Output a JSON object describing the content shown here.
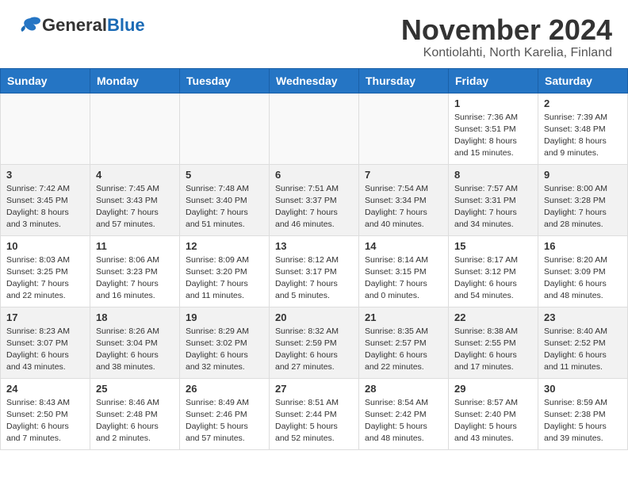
{
  "header": {
    "logo_general": "General",
    "logo_blue": "Blue",
    "title": "November 2024",
    "location": "Kontiolahti, North Karelia, Finland"
  },
  "days_of_week": [
    "Sunday",
    "Monday",
    "Tuesday",
    "Wednesday",
    "Thursday",
    "Friday",
    "Saturday"
  ],
  "weeks": [
    [
      {
        "day": "",
        "info": "",
        "empty": true
      },
      {
        "day": "",
        "info": "",
        "empty": true
      },
      {
        "day": "",
        "info": "",
        "empty": true
      },
      {
        "day": "",
        "info": "",
        "empty": true
      },
      {
        "day": "",
        "info": "",
        "empty": true
      },
      {
        "day": "1",
        "info": "Sunrise: 7:36 AM\nSunset: 3:51 PM\nDaylight: 8 hours\nand 15 minutes."
      },
      {
        "day": "2",
        "info": "Sunrise: 7:39 AM\nSunset: 3:48 PM\nDaylight: 8 hours\nand 9 minutes."
      }
    ],
    [
      {
        "day": "3",
        "info": "Sunrise: 7:42 AM\nSunset: 3:45 PM\nDaylight: 8 hours\nand 3 minutes."
      },
      {
        "day": "4",
        "info": "Sunrise: 7:45 AM\nSunset: 3:43 PM\nDaylight: 7 hours\nand 57 minutes."
      },
      {
        "day": "5",
        "info": "Sunrise: 7:48 AM\nSunset: 3:40 PM\nDaylight: 7 hours\nand 51 minutes."
      },
      {
        "day": "6",
        "info": "Sunrise: 7:51 AM\nSunset: 3:37 PM\nDaylight: 7 hours\nand 46 minutes."
      },
      {
        "day": "7",
        "info": "Sunrise: 7:54 AM\nSunset: 3:34 PM\nDaylight: 7 hours\nand 40 minutes."
      },
      {
        "day": "8",
        "info": "Sunrise: 7:57 AM\nSunset: 3:31 PM\nDaylight: 7 hours\nand 34 minutes."
      },
      {
        "day": "9",
        "info": "Sunrise: 8:00 AM\nSunset: 3:28 PM\nDaylight: 7 hours\nand 28 minutes."
      }
    ],
    [
      {
        "day": "10",
        "info": "Sunrise: 8:03 AM\nSunset: 3:25 PM\nDaylight: 7 hours\nand 22 minutes."
      },
      {
        "day": "11",
        "info": "Sunrise: 8:06 AM\nSunset: 3:23 PM\nDaylight: 7 hours\nand 16 minutes."
      },
      {
        "day": "12",
        "info": "Sunrise: 8:09 AM\nSunset: 3:20 PM\nDaylight: 7 hours\nand 11 minutes."
      },
      {
        "day": "13",
        "info": "Sunrise: 8:12 AM\nSunset: 3:17 PM\nDaylight: 7 hours\nand 5 minutes."
      },
      {
        "day": "14",
        "info": "Sunrise: 8:14 AM\nSunset: 3:15 PM\nDaylight: 7 hours\nand 0 minutes."
      },
      {
        "day": "15",
        "info": "Sunrise: 8:17 AM\nSunset: 3:12 PM\nDaylight: 6 hours\nand 54 minutes."
      },
      {
        "day": "16",
        "info": "Sunrise: 8:20 AM\nSunset: 3:09 PM\nDaylight: 6 hours\nand 48 minutes."
      }
    ],
    [
      {
        "day": "17",
        "info": "Sunrise: 8:23 AM\nSunset: 3:07 PM\nDaylight: 6 hours\nand 43 minutes."
      },
      {
        "day": "18",
        "info": "Sunrise: 8:26 AM\nSunset: 3:04 PM\nDaylight: 6 hours\nand 38 minutes."
      },
      {
        "day": "19",
        "info": "Sunrise: 8:29 AM\nSunset: 3:02 PM\nDaylight: 6 hours\nand 32 minutes."
      },
      {
        "day": "20",
        "info": "Sunrise: 8:32 AM\nSunset: 2:59 PM\nDaylight: 6 hours\nand 27 minutes."
      },
      {
        "day": "21",
        "info": "Sunrise: 8:35 AM\nSunset: 2:57 PM\nDaylight: 6 hours\nand 22 minutes."
      },
      {
        "day": "22",
        "info": "Sunrise: 8:38 AM\nSunset: 2:55 PM\nDaylight: 6 hours\nand 17 minutes."
      },
      {
        "day": "23",
        "info": "Sunrise: 8:40 AM\nSunset: 2:52 PM\nDaylight: 6 hours\nand 11 minutes."
      }
    ],
    [
      {
        "day": "24",
        "info": "Sunrise: 8:43 AM\nSunset: 2:50 PM\nDaylight: 6 hours\nand 7 minutes."
      },
      {
        "day": "25",
        "info": "Sunrise: 8:46 AM\nSunset: 2:48 PM\nDaylight: 6 hours\nand 2 minutes."
      },
      {
        "day": "26",
        "info": "Sunrise: 8:49 AM\nSunset: 2:46 PM\nDaylight: 5 hours\nand 57 minutes."
      },
      {
        "day": "27",
        "info": "Sunrise: 8:51 AM\nSunset: 2:44 PM\nDaylight: 5 hours\nand 52 minutes."
      },
      {
        "day": "28",
        "info": "Sunrise: 8:54 AM\nSunset: 2:42 PM\nDaylight: 5 hours\nand 48 minutes."
      },
      {
        "day": "29",
        "info": "Sunrise: 8:57 AM\nSunset: 2:40 PM\nDaylight: 5 hours\nand 43 minutes."
      },
      {
        "day": "30",
        "info": "Sunrise: 8:59 AM\nSunset: 2:38 PM\nDaylight: 5 hours\nand 39 minutes."
      }
    ]
  ]
}
